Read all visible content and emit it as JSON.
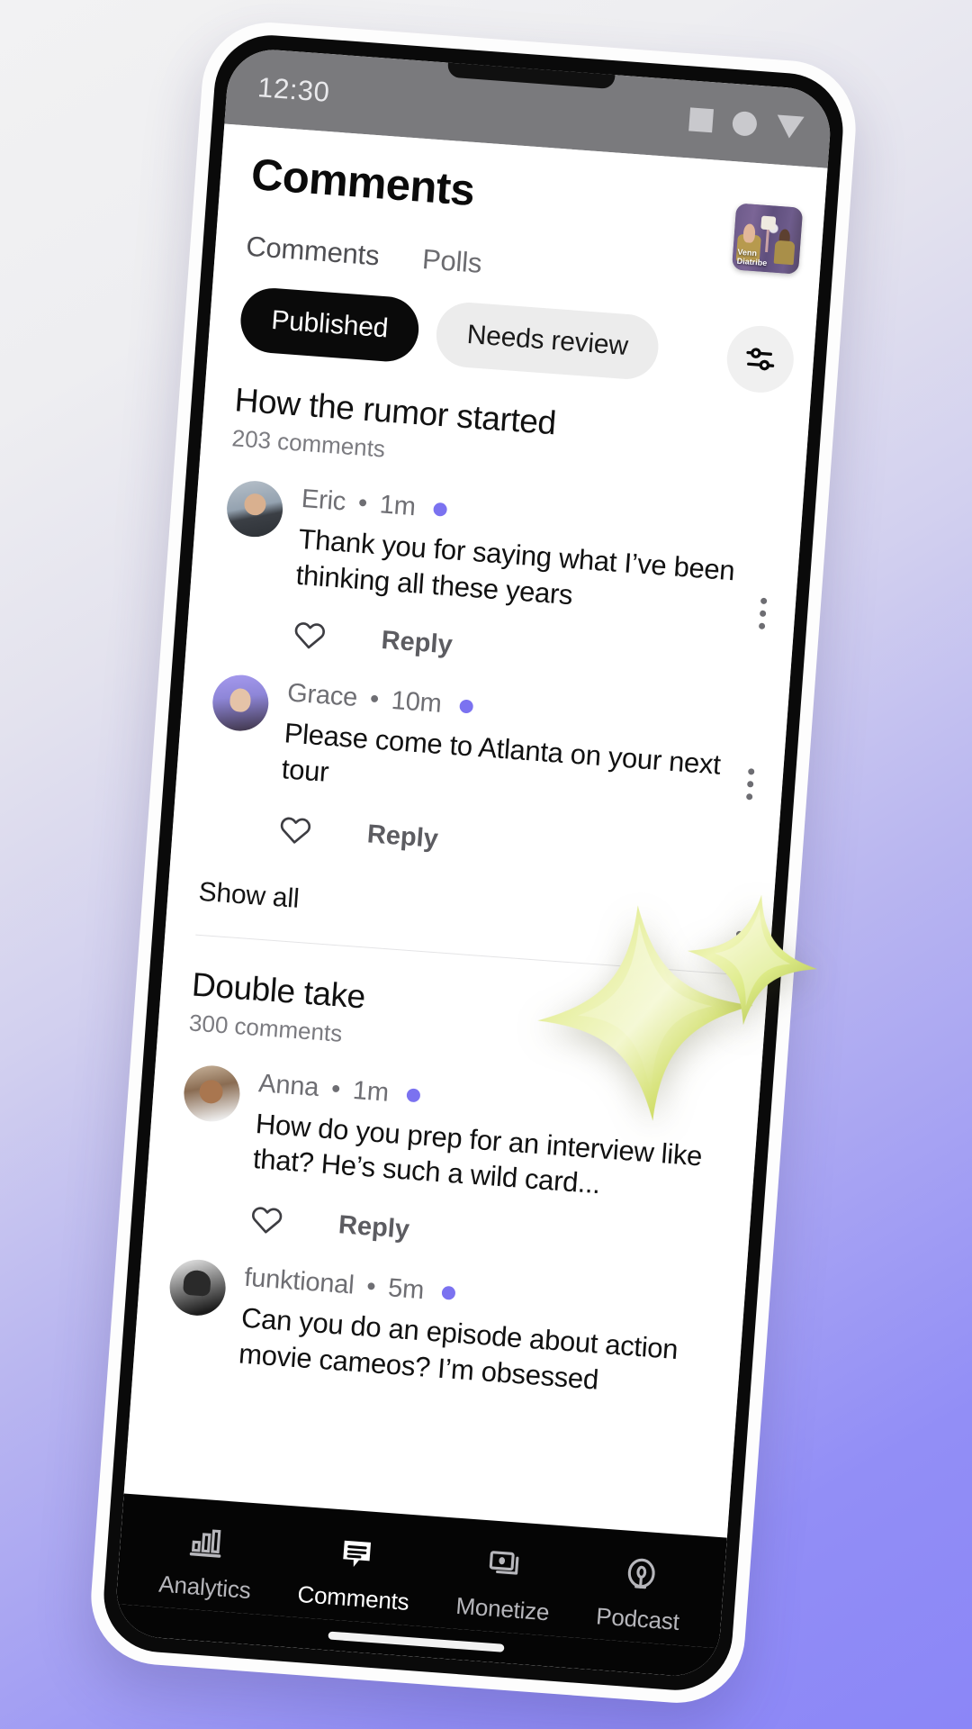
{
  "background": {
    "gradient_from": "#f2f2f3",
    "gradient_to": "#8b86f7"
  },
  "status_bar": {
    "time": "12:30",
    "icons": [
      "square-icon",
      "circle-icon",
      "triangle-down-icon"
    ]
  },
  "header": {
    "title": "Comments",
    "podcast_thumbnail": {
      "name": "podcast-cover-art",
      "label_line1": "Venn",
      "label_line2": "Diatribe"
    }
  },
  "tabs": [
    {
      "label": "Comments",
      "active": true
    },
    {
      "label": "Polls",
      "active": false
    }
  ],
  "filter_chips": [
    {
      "label": "Published",
      "selected": true
    },
    {
      "label": "Needs review",
      "selected": false
    }
  ],
  "filter_button": {
    "icon": "sliders-icon"
  },
  "accent_colors": {
    "unread_dot": "#7b72f0",
    "chip_selected_bg": "#0a0a0a",
    "chip_unselected_bg": "#ececec",
    "star": "#cddc63"
  },
  "groups": [
    {
      "title": "How the rumor started",
      "count_label": "203 comments",
      "comments": [
        {
          "author": "Eric",
          "time": "1m",
          "separator": "•",
          "unread": true,
          "avatar": "avatar-eric",
          "text": "Thank you for saying what I’ve been thinking all these years",
          "like_icon": "heart-icon",
          "reply_label": "Reply",
          "menu_icon": "kebab-menu-icon"
        },
        {
          "author": "Grace",
          "time": "10m",
          "separator": "•",
          "unread": true,
          "avatar": "avatar-grace",
          "text": "Please come to Atlanta on your next tour",
          "like_icon": "heart-icon",
          "reply_label": "Reply",
          "menu_icon": "kebab-menu-icon"
        }
      ],
      "show_all_label": "Show all"
    },
    {
      "title": "Double take",
      "count_label": "300 comments",
      "comments": [
        {
          "author": "Anna",
          "time": "1m",
          "separator": "•",
          "unread": true,
          "avatar": "avatar-anna",
          "text": "How do you prep for an interview like that? He’s such a wild card...",
          "like_icon": "heart-icon",
          "reply_label": "Reply",
          "menu_icon": "kebab-menu-icon"
        },
        {
          "author": "funktional",
          "time": "5m",
          "separator": "•",
          "unread": true,
          "avatar": "avatar-funktional",
          "text": "Can you do an episode about action movie cameos? I’m obsessed",
          "like_icon": "heart-icon",
          "reply_label": "Reply",
          "menu_icon": "kebab-menu-icon"
        }
      ]
    }
  ],
  "bottom_nav": [
    {
      "label": "Analytics",
      "icon": "bar-chart-icon",
      "active": false
    },
    {
      "label": "Comments",
      "icon": "comment-bubble-icon",
      "active": true
    },
    {
      "label": "Monetize",
      "icon": "monitor-stack-icon",
      "active": false
    },
    {
      "label": "Podcast",
      "icon": "microphone-icon",
      "active": false
    }
  ],
  "decorations": [
    {
      "name": "star-sparkle-large"
    },
    {
      "name": "star-sparkle-small"
    }
  ]
}
